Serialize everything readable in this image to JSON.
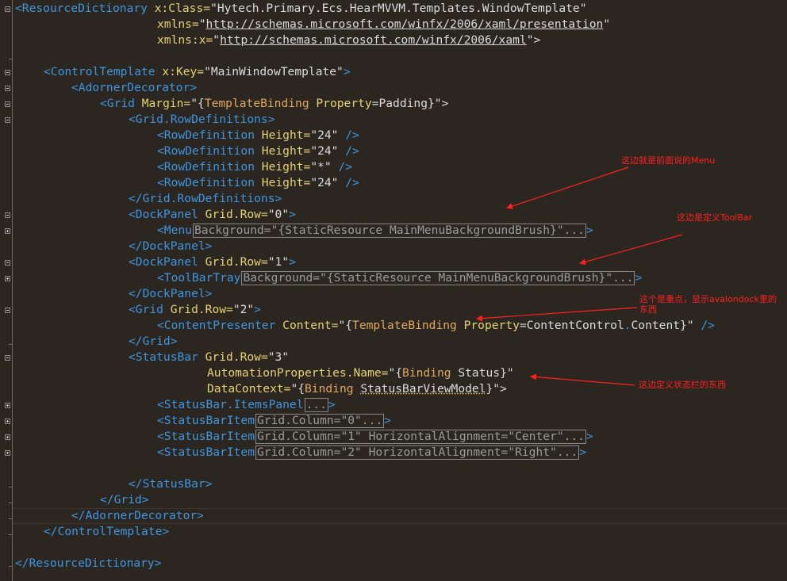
{
  "lines": {
    "l1_open": "<",
    "l1_tag": "ResourceDictionary",
    "l1_attr": " x:Class=",
    "l1_val": "\"Hytech.Primary.Ecs.HearMVVM.Templates.WindowTemplate\"",
    "l2_attr": "xmlns=",
    "l2_q1": "\"",
    "l2_url": "http://schemas.microsoft.com/winfx/2006/xaml/presentation",
    "l2_q2": "\"",
    "l3_attr": "xmlns:x=",
    "l3_q1": "\"",
    "l3_url": "http://schemas.microsoft.com/winfx/2006/xaml",
    "l3_q2": "\">",
    "l5_tag": "<ControlTemplate",
    "l5_attr": " x:Key=",
    "l5_val": "\"MainWindowTemplate\"",
    "l5_close": ">",
    "l6": "<AdornerDecorator>",
    "l7_tag": "<Grid",
    "l7_attr": " Margin=",
    "l7_q": "\"{",
    "l7_kw": "TemplateBinding",
    "l7_prop": " Property",
    "l7_eq": "=",
    "l7_val": "Padding",
    "l7_close": "}\">",
    "l8": "<Grid.RowDefinitions>",
    "rowdef_tag": "<RowDefinition",
    "rowdef_attr": " Height=",
    "rowdef_val_1": "\"24\"",
    "rowdef_val_2": "\"24\"",
    "rowdef_val_3": "\"*\"",
    "rowdef_val_4": "\"24\"",
    "rowdef_close": " />",
    "l13": "</Grid.RowDefinitions>",
    "dock_tag": "<DockPanel",
    "gridrow_attr": " Grid.Row=",
    "l14_val": "\"0\"",
    "gt": ">",
    "l15_tag": "<Menu",
    "l15_collapsed": "Background=\"{StaticResource MainMenuBackgroundBrush}\"...",
    "l16": "</DockPanel>",
    "l17_val": "\"1\"",
    "l18_tag": "<ToolBarTray",
    "l18_collapsed": "Background=\"{StaticResource MainMenuBackgroundBrush}\"...",
    "l19": "</DockPanel>",
    "l20_tag": "<Grid",
    "l20_val": "\"2\"",
    "l21_tag": "<ContentPresenter",
    "l21_attr": " Content=",
    "l21_q": "\"{",
    "l21_kw": "TemplateBinding",
    "l21_prop": " Property",
    "l21_eq": "=",
    "l21_val1": "ContentControl",
    "l21_dot": ".",
    "l21_val2": "Content",
    "l21_close": "}\"",
    "l21_end": " />",
    "l22": "</Grid>",
    "l23_tag": "<StatusBar",
    "l23_val": "\"3\"",
    "l24_attr": "AutomationProperties.Name=",
    "l24_q": "\"{",
    "l24_kw": "Binding",
    "l24_val": " Status",
    "l24_close": "}\"",
    "l25_attr": "DataContext=",
    "l25_q": "\"{",
    "l25_kw": "Binding",
    "l25_sp": " ",
    "l25_val": "StatusBarViewModel",
    "l25_close": "}\">",
    "l26_tag": "<StatusBar.ItemsPanel",
    "l26_collapsed": "...",
    "sbi_tag": "<StatusBarItem",
    "l27_collapsed": "Grid.Column=\"0\"...",
    "l28_collapsed": "Grid.Column=\"1\" HorizontalAlignment=\"Center\"...",
    "l29_collapsed": "Grid.Column=\"2\" HorizontalAlignment=\"Right\"...",
    "l31": "</StatusBar>",
    "l32": "</Grid>",
    "l33": "</AdornerDecorator>",
    "l34": "</ControlTemplate>",
    "l36": "</ResourceDictionary>"
  },
  "annotations": {
    "menu": "这边就是前面说的Menu",
    "toolbar": "这边是定义ToolBar",
    "content_1": "这个是重点，显示avalondock里的",
    "content_2": "东西",
    "statusbar": "这边定义状态栏的东西"
  },
  "colors": {
    "background": "#2c2621",
    "tag": "#3d96e0",
    "attribute": "#e7d275",
    "value": "#dcdcdc",
    "keyword": "#e0a860",
    "annotation": "#ff2020"
  }
}
